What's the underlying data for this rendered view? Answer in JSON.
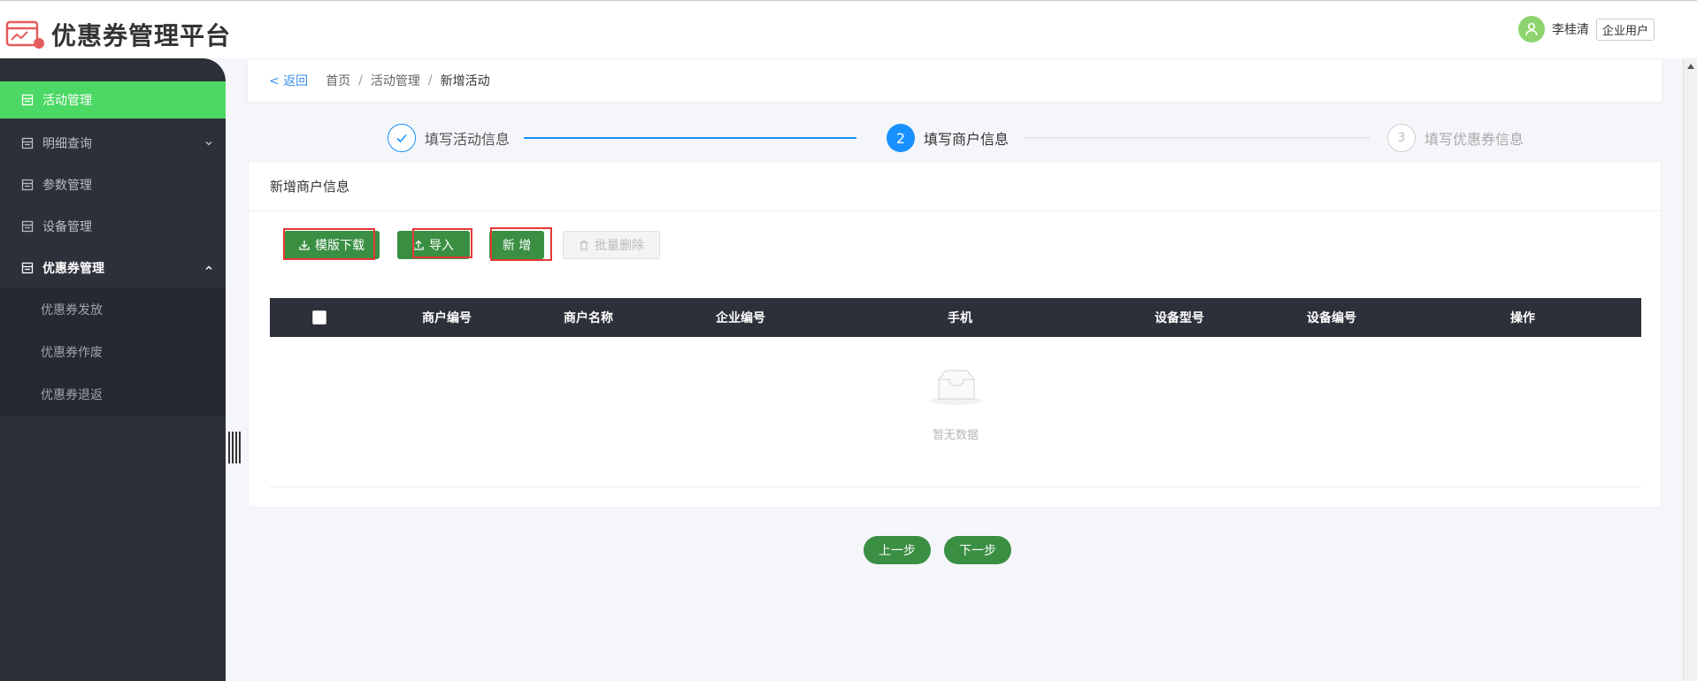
{
  "app": {
    "title": "优惠券管理平台"
  },
  "user": {
    "name": "李桂清",
    "role": "企业用户"
  },
  "sidebar": {
    "items": [
      {
        "label": "活动管理",
        "active": true
      },
      {
        "label": "明细查询",
        "expandable": true
      },
      {
        "label": "参数管理"
      },
      {
        "label": "设备管理"
      },
      {
        "label": "优惠券管理",
        "expanded": true,
        "children": [
          {
            "label": "优惠券发放"
          },
          {
            "label": "优惠券作废"
          },
          {
            "label": "优惠券退返"
          }
        ]
      }
    ]
  },
  "breadcrumb": {
    "back": "< 返回",
    "items": [
      "首页",
      "活动管理",
      "新增活动"
    ],
    "separator": "/"
  },
  "steps": [
    {
      "index": "",
      "label": "填写活动信息",
      "status": "done"
    },
    {
      "index": "2",
      "label": "填写商户信息",
      "status": "current"
    },
    {
      "index": "3",
      "label": "填写优惠券信息",
      "status": "todo"
    }
  ],
  "card": {
    "title": "新增商户信息",
    "buttons": {
      "download": "模版下载",
      "import": "导入",
      "add": "新 增",
      "batch_delete": "批量删除"
    },
    "table": {
      "columns": [
        "商户编号",
        "商户名称",
        "企业编号",
        "手机",
        "设备型号",
        "设备编号",
        "操作"
      ],
      "rows": [],
      "empty_text": "暂无数据"
    }
  },
  "footer": {
    "prev": "上一步",
    "next": "下一步"
  },
  "colors": {
    "accent_green": "#4cd864",
    "button_green": "#3a8f43",
    "step_blue": "#1890ff",
    "sidebar_bg": "#2d3039",
    "annotation_red": "#e53935"
  }
}
